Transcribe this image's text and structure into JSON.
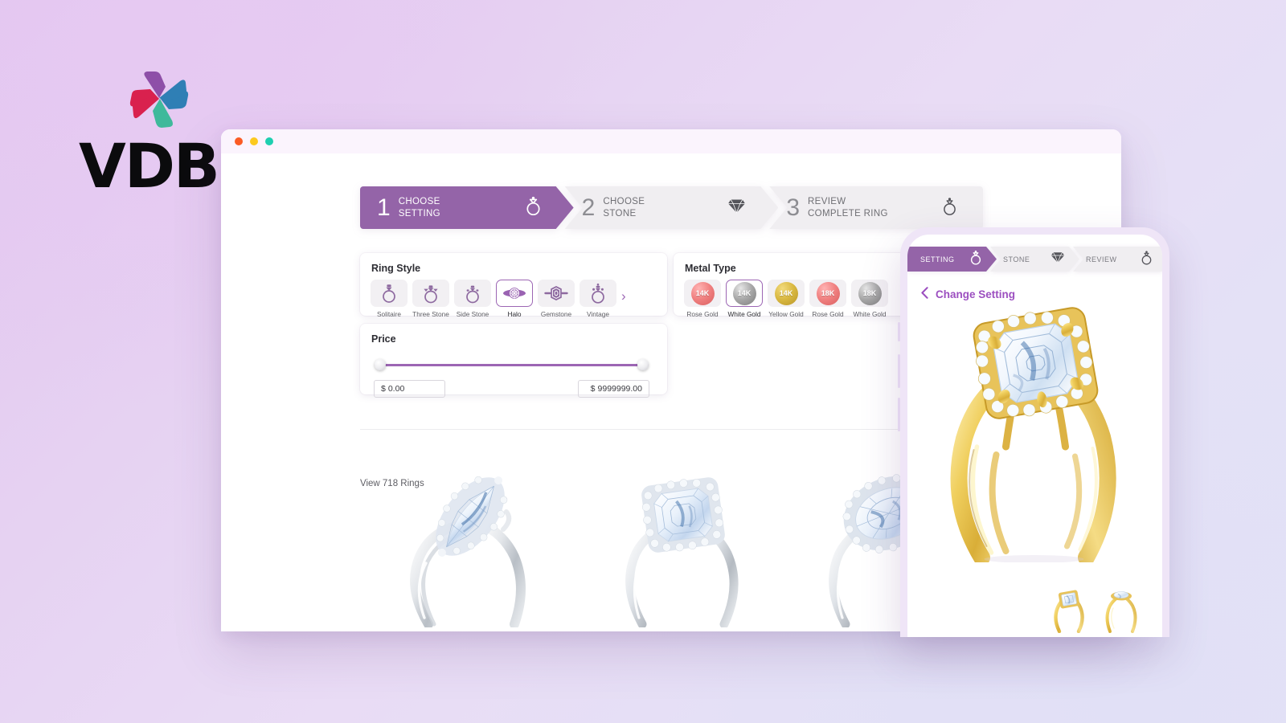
{
  "brand": {
    "name": "VDB",
    "logo_icon": "vdb-pinwheel-logo"
  },
  "browser": {
    "traffic_lights": [
      {
        "name": "close",
        "color": "#fb5b24"
      },
      {
        "name": "minimize",
        "color": "#fcc91f"
      },
      {
        "name": "zoom",
        "color": "#1ecfb0"
      }
    ]
  },
  "stepper": {
    "steps": [
      {
        "number": "1",
        "line1": "CHOOSE",
        "line2": "SETTING",
        "icon": "ring-icon",
        "active": true
      },
      {
        "number": "2",
        "line1": "CHOOSE",
        "line2": "STONE",
        "icon": "diamond-icon",
        "active": false
      },
      {
        "number": "3",
        "line1": "REVIEW",
        "line2": "COMPLETE RING",
        "icon": "ring-icon",
        "active": false
      }
    ]
  },
  "filters": {
    "ring_style": {
      "title": "Ring Style",
      "next_arrow": "›",
      "options": [
        {
          "label": "Solitaire",
          "icon": "ring-solitaire-icon",
          "selected": false
        },
        {
          "label": "Three Stone",
          "icon": "ring-three-stone-icon",
          "selected": false
        },
        {
          "label": "Side Stone",
          "icon": "ring-side-stone-icon",
          "selected": false
        },
        {
          "label": "Halo",
          "icon": "ring-halo-icon",
          "selected": true
        },
        {
          "label": "Gemstone",
          "icon": "ring-gemstone-icon",
          "selected": false
        },
        {
          "label": "Vintage",
          "icon": "ring-vintage-icon",
          "selected": false
        }
      ]
    },
    "metal_type": {
      "title": "Metal Type",
      "options": [
        {
          "karat": "14K",
          "label": "Rose Gold",
          "swatch": "rose",
          "selected": false
        },
        {
          "karat": "14K",
          "label": "White Gold",
          "swatch": "white",
          "selected": true
        },
        {
          "karat": "14K",
          "label": "Yellow Gold",
          "swatch": "yellow",
          "selected": false
        },
        {
          "karat": "18K",
          "label": "Rose Gold",
          "swatch": "rose",
          "selected": false
        },
        {
          "karat": "18K",
          "label": "White Gold",
          "swatch": "white",
          "selected": false
        }
      ]
    },
    "price": {
      "title": "Price",
      "currency": "$",
      "min_value": "0.00",
      "max_value": "9999999.00"
    }
  },
  "results": {
    "view_count_label": "View 718 Rings",
    "products": [
      {
        "name": "marquise-halo-twist-ring",
        "metal": "white-gold",
        "shape": "marquise"
      },
      {
        "name": "asscher-halo-ring",
        "metal": "white-gold",
        "shape": "asscher"
      },
      {
        "name": "oval-halo-ring",
        "metal": "white-gold",
        "shape": "oval"
      }
    ]
  },
  "phone": {
    "stepper": {
      "steps": [
        {
          "label": "SETTING",
          "icon": "ring-icon",
          "active": true
        },
        {
          "label": "STONE",
          "icon": "diamond-icon",
          "active": false
        },
        {
          "label": "REVIEW",
          "icon": "ring-icon",
          "active": false
        }
      ]
    },
    "back_link": {
      "label": "Change Setting",
      "icon": "chevron-left-icon"
    },
    "hero": {
      "name": "asscher-halo-ring-yellow-gold",
      "metal": "yellow-gold",
      "shape": "asscher"
    },
    "thumbnails": [
      {
        "name": "ring-thumbnail-front",
        "metal": "yellow-gold"
      },
      {
        "name": "ring-thumbnail-side",
        "metal": "yellow-gold"
      }
    ]
  },
  "colors": {
    "accent_purple": "#9464a8",
    "link_purple": "#9c4fc0",
    "panel_bg": "#ffffff",
    "chip_bg": "#f2f0f3",
    "bg_gradient_start": "#e2c6ef",
    "bg_gradient_end": "#e3e2f7"
  }
}
